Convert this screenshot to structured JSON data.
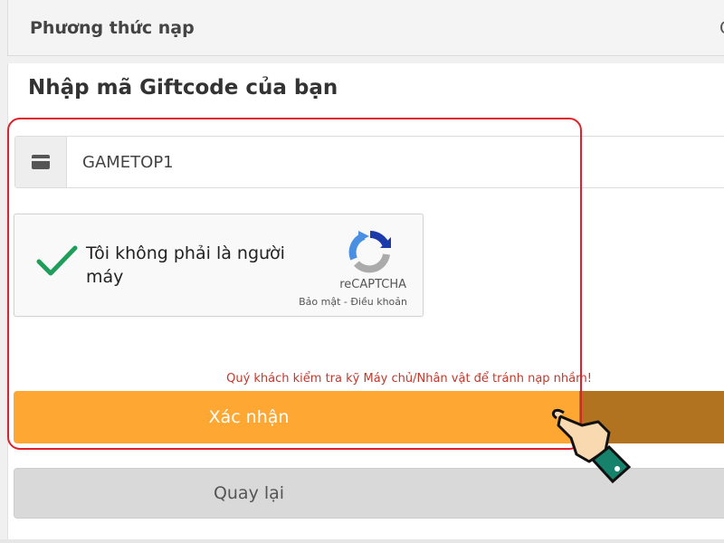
{
  "method": {
    "label": "Phương thức nạp",
    "value": "C"
  },
  "form": {
    "title": "Nhập mã Giftcode của bạn",
    "code_value": "GAMETOP1",
    "addon_icon": "card-icon"
  },
  "recaptcha": {
    "label": "Tôi không phải là người máy",
    "brand": "reCAPTCHA",
    "links": "Bảo mật - Điều khoản",
    "checked": true
  },
  "warning": "Quý khách kiểm tra kỹ Máy chủ/Nhân vật để tránh nạp nhầm!",
  "buttons": {
    "confirm_label": "Xác nhận",
    "back_label": "Quay lại"
  },
  "colors": {
    "confirm": "#ffa733",
    "highlight": "#e0202a",
    "check": "#1e9e5a",
    "warning": "#c0392b"
  }
}
